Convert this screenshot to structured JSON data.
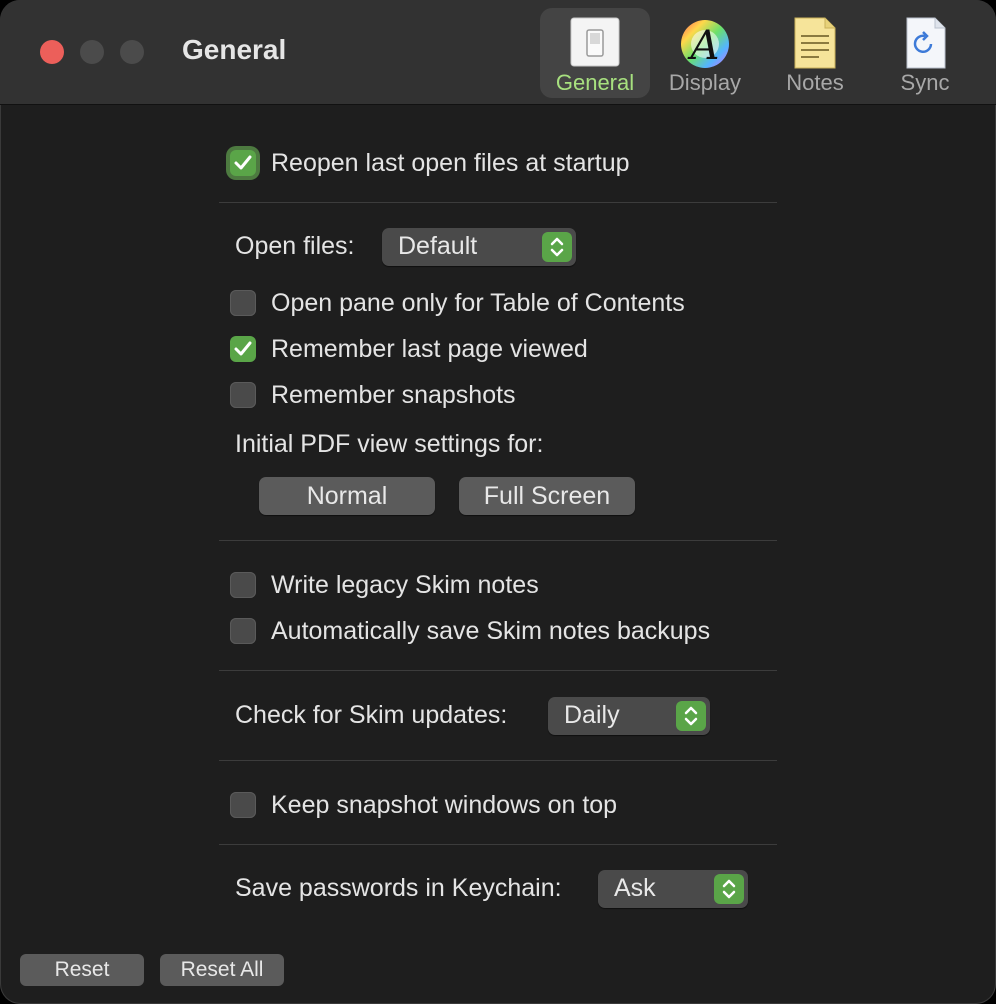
{
  "window": {
    "title": "General"
  },
  "toolbar": {
    "items": [
      {
        "label": "General",
        "icon": "general-switch-icon",
        "selected": true
      },
      {
        "label": "Display",
        "icon": "display-font-icon",
        "selected": false
      },
      {
        "label": "Notes",
        "icon": "notes-page-icon",
        "selected": false
      },
      {
        "label": "Sync",
        "icon": "sync-document-icon",
        "selected": false
      }
    ]
  },
  "settings": {
    "reopen_last_files": {
      "label": "Reopen last open files at startup",
      "checked": true
    },
    "open_files": {
      "label": "Open files:",
      "value": "Default"
    },
    "open_pane_toc": {
      "label": "Open pane only for Table of Contents",
      "checked": false
    },
    "remember_last_page": {
      "label": "Remember last page viewed",
      "checked": true
    },
    "remember_snapshots": {
      "label": "Remember snapshots",
      "checked": false
    },
    "initial_pdf_view": {
      "label": "Initial PDF view settings for:",
      "normal_label": "Normal",
      "full_screen_label": "Full Screen"
    },
    "write_legacy_notes": {
      "label": "Write legacy Skim notes",
      "checked": false
    },
    "auto_save_backups": {
      "label": "Automatically save Skim notes backups",
      "checked": false
    },
    "check_updates": {
      "label": "Check for Skim updates:",
      "value": "Daily"
    },
    "keep_snapshots_on_top": {
      "label": "Keep snapshot windows on top",
      "checked": false
    },
    "save_passwords": {
      "label": "Save passwords in Keychain:",
      "value": "Ask"
    }
  },
  "footer": {
    "reset_label": "Reset",
    "reset_all_label": "Reset All"
  },
  "colors": {
    "accent": "#5aa548",
    "selected_tab_text": "#a7e07f",
    "close_button": "#ec5f5a"
  }
}
